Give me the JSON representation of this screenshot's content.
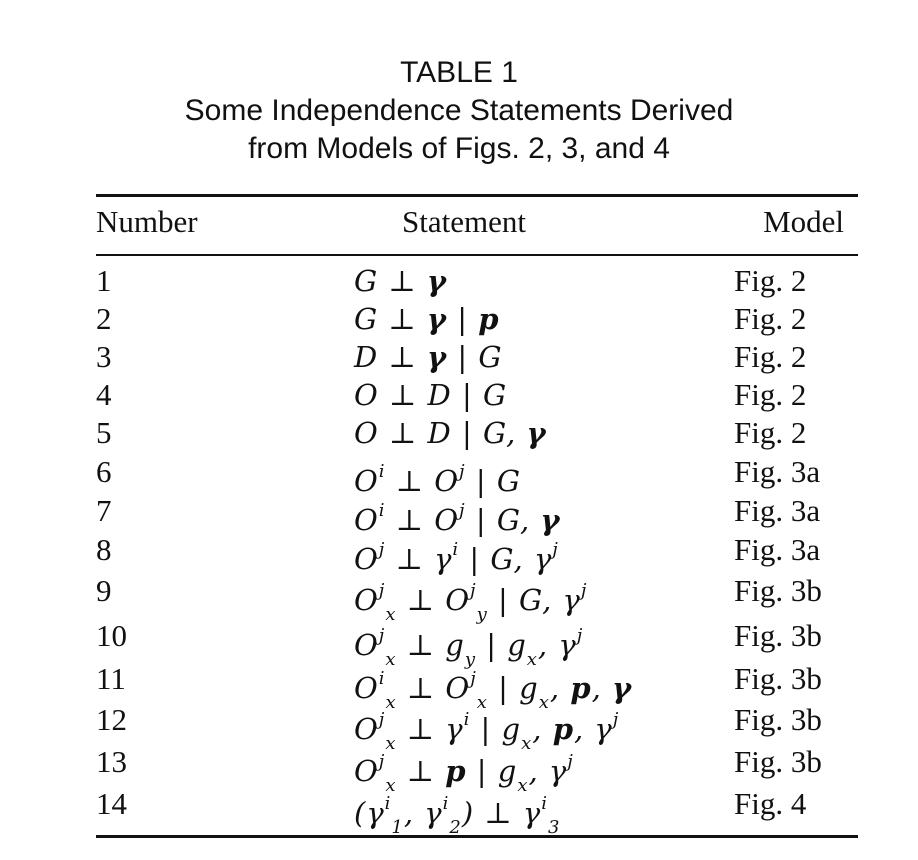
{
  "caption": {
    "line1": "TABLE 1",
    "line2": "Some Independence Statements Derived",
    "line3": "from Models of Figs. 2, 3, and 4"
  },
  "table": {
    "headers": [
      "Number",
      "Statement",
      "Model"
    ],
    "rows": [
      {
        "number": "1",
        "statement": "G ⊥ <b>γ</b>",
        "model": "Fig. 2"
      },
      {
        "number": "2",
        "statement": "G ⊥ <b>γ</b> | <b>p</b>",
        "model": "Fig. 2"
      },
      {
        "number": "3",
        "statement": "D ⊥ <b>γ</b> | G",
        "model": "Fig. 2"
      },
      {
        "number": "4",
        "statement": "O ⊥ D | G",
        "model": "Fig. 2"
      },
      {
        "number": "5",
        "statement": "O ⊥ D | G, <b>γ</b>",
        "model": "Fig. 2"
      },
      {
        "number": "6",
        "statement": "O<sup>i</sup> ⊥ O<sup>j</sup> | G",
        "model": "Fig. 3a"
      },
      {
        "number": "7",
        "statement": "O<sup>i</sup> ⊥ O<sup>j</sup> | G, <b>γ</b>",
        "model": "Fig. 3a"
      },
      {
        "number": "8",
        "statement": "O<sup>j</sup> ⊥ γ<sup>i</sup> | G, γ<sup>j</sup>",
        "model": "Fig. 3a"
      },
      {
        "number": "9",
        "statement": "O<sup>j</sup><sub>x</sub> ⊥ O<sup>j</sup><sub>y</sub> | G, γ<sup>j</sup>",
        "model": "Fig. 3b"
      },
      {
        "number": "10",
        "statement": "O<sup>j</sup><sub>x</sub> ⊥ g<sub>y</sub> | g<sub>x</sub>, γ<sup>j</sup>",
        "model": "Fig. 3b"
      },
      {
        "number": "11",
        "statement": "O<sup>i</sup><sub>x</sub> ⊥ O<sup>j</sup><sub>x</sub> | g<sub>x</sub>, <b>p</b>, <b>γ</b>",
        "model": "Fig. 3b"
      },
      {
        "number": "12",
        "statement": "O<sup>j</sup><sub>x</sub> ⊥ γ<sup>i</sup> | g<sub>x</sub>, <b>p</b>, γ<sup>j</sup>",
        "model": "Fig. 3b"
      },
      {
        "number": "13",
        "statement": "O<sup>j</sup><sub>x</sub> ⊥ <b>p</b> | g<sub>x</sub>, γ<sup>j</sup>",
        "model": "Fig. 3b"
      },
      {
        "number": "14",
        "statement": "(γ<sup>i</sup><sub>1</sub>, γ<sup>i</sup><sub>2</sub>) ⊥ γ<sup>i</sup><sub>3</sub>",
        "model": "Fig. 4"
      }
    ]
  }
}
